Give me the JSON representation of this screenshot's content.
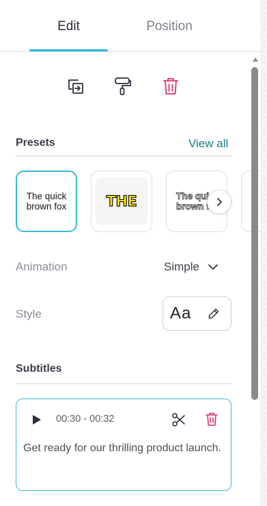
{
  "tabs": [
    {
      "label": "Edit",
      "active": true
    },
    {
      "label": "Position",
      "active": false
    }
  ],
  "toolbar": {
    "icons": [
      "replace-icon",
      "paint-roller-icon",
      "trash-icon"
    ]
  },
  "presets": {
    "title": "Presets",
    "view_all": "View all",
    "items": [
      {
        "line1": "The quick",
        "line2": "brown fox",
        "style": "plain",
        "selected": true
      },
      {
        "text": "THE",
        "style": "yellow-outline"
      },
      {
        "line1": "The quick",
        "line2": "brown fox",
        "style": "white-outline"
      }
    ]
  },
  "animation": {
    "label": "Animation",
    "value": "Simple"
  },
  "style": {
    "label": "Style",
    "preview": "Aa"
  },
  "subtitles": {
    "title": "Subtitles",
    "items": [
      {
        "time": "00:30 - 00:32",
        "text": "Get ready for our thrilling product launch."
      }
    ]
  },
  "colors": {
    "accent": "#27b5e4",
    "delete": "#d6336c",
    "link": "#1a7a8c"
  }
}
